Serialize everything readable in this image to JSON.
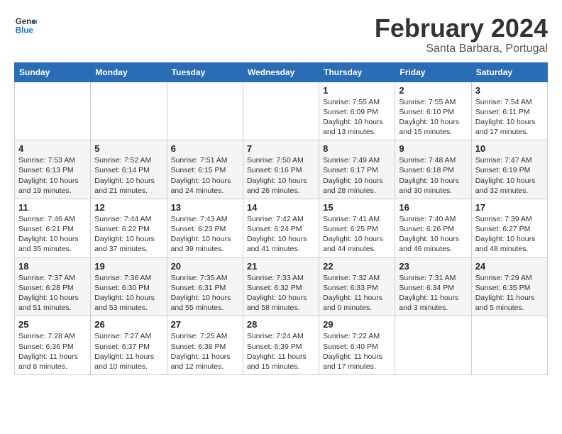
{
  "header": {
    "logo_line1": "General",
    "logo_line2": "Blue",
    "month_title": "February 2024",
    "location": "Santa Barbara, Portugal"
  },
  "weekdays": [
    "Sunday",
    "Monday",
    "Tuesday",
    "Wednesday",
    "Thursday",
    "Friday",
    "Saturday"
  ],
  "weeks": [
    [
      {
        "num": "",
        "info": ""
      },
      {
        "num": "",
        "info": ""
      },
      {
        "num": "",
        "info": ""
      },
      {
        "num": "",
        "info": ""
      },
      {
        "num": "1",
        "info": "Sunrise: 7:55 AM\nSunset: 6:09 PM\nDaylight: 10 hours\nand 13 minutes."
      },
      {
        "num": "2",
        "info": "Sunrise: 7:55 AM\nSunset: 6:10 PM\nDaylight: 10 hours\nand 15 minutes."
      },
      {
        "num": "3",
        "info": "Sunrise: 7:54 AM\nSunset: 6:11 PM\nDaylight: 10 hours\nand 17 minutes."
      }
    ],
    [
      {
        "num": "4",
        "info": "Sunrise: 7:53 AM\nSunset: 6:13 PM\nDaylight: 10 hours\nand 19 minutes."
      },
      {
        "num": "5",
        "info": "Sunrise: 7:52 AM\nSunset: 6:14 PM\nDaylight: 10 hours\nand 21 minutes."
      },
      {
        "num": "6",
        "info": "Sunrise: 7:51 AM\nSunset: 6:15 PM\nDaylight: 10 hours\nand 24 minutes."
      },
      {
        "num": "7",
        "info": "Sunrise: 7:50 AM\nSunset: 6:16 PM\nDaylight: 10 hours\nand 26 minutes."
      },
      {
        "num": "8",
        "info": "Sunrise: 7:49 AM\nSunset: 6:17 PM\nDaylight: 10 hours\nand 28 minutes."
      },
      {
        "num": "9",
        "info": "Sunrise: 7:48 AM\nSunset: 6:18 PM\nDaylight: 10 hours\nand 30 minutes."
      },
      {
        "num": "10",
        "info": "Sunrise: 7:47 AM\nSunset: 6:19 PM\nDaylight: 10 hours\nand 32 minutes."
      }
    ],
    [
      {
        "num": "11",
        "info": "Sunrise: 7:46 AM\nSunset: 6:21 PM\nDaylight: 10 hours\nand 35 minutes."
      },
      {
        "num": "12",
        "info": "Sunrise: 7:44 AM\nSunset: 6:22 PM\nDaylight: 10 hours\nand 37 minutes."
      },
      {
        "num": "13",
        "info": "Sunrise: 7:43 AM\nSunset: 6:23 PM\nDaylight: 10 hours\nand 39 minutes."
      },
      {
        "num": "14",
        "info": "Sunrise: 7:42 AM\nSunset: 6:24 PM\nDaylight: 10 hours\nand 41 minutes."
      },
      {
        "num": "15",
        "info": "Sunrise: 7:41 AM\nSunset: 6:25 PM\nDaylight: 10 hours\nand 44 minutes."
      },
      {
        "num": "16",
        "info": "Sunrise: 7:40 AM\nSunset: 6:26 PM\nDaylight: 10 hours\nand 46 minutes."
      },
      {
        "num": "17",
        "info": "Sunrise: 7:39 AM\nSunset: 6:27 PM\nDaylight: 10 hours\nand 48 minutes."
      }
    ],
    [
      {
        "num": "18",
        "info": "Sunrise: 7:37 AM\nSunset: 6:28 PM\nDaylight: 10 hours\nand 51 minutes."
      },
      {
        "num": "19",
        "info": "Sunrise: 7:36 AM\nSunset: 6:30 PM\nDaylight: 10 hours\nand 53 minutes."
      },
      {
        "num": "20",
        "info": "Sunrise: 7:35 AM\nSunset: 6:31 PM\nDaylight: 10 hours\nand 55 minutes."
      },
      {
        "num": "21",
        "info": "Sunrise: 7:33 AM\nSunset: 6:32 PM\nDaylight: 10 hours\nand 58 minutes."
      },
      {
        "num": "22",
        "info": "Sunrise: 7:32 AM\nSunset: 6:33 PM\nDaylight: 11 hours\nand 0 minutes."
      },
      {
        "num": "23",
        "info": "Sunrise: 7:31 AM\nSunset: 6:34 PM\nDaylight: 11 hours\nand 3 minutes."
      },
      {
        "num": "24",
        "info": "Sunrise: 7:29 AM\nSunset: 6:35 PM\nDaylight: 11 hours\nand 5 minutes."
      }
    ],
    [
      {
        "num": "25",
        "info": "Sunrise: 7:28 AM\nSunset: 6:36 PM\nDaylight: 11 hours\nand 8 minutes."
      },
      {
        "num": "26",
        "info": "Sunrise: 7:27 AM\nSunset: 6:37 PM\nDaylight: 11 hours\nand 10 minutes."
      },
      {
        "num": "27",
        "info": "Sunrise: 7:25 AM\nSunset: 6:38 PM\nDaylight: 11 hours\nand 12 minutes."
      },
      {
        "num": "28",
        "info": "Sunrise: 7:24 AM\nSunset: 6:39 PM\nDaylight: 11 hours\nand 15 minutes."
      },
      {
        "num": "29",
        "info": "Sunrise: 7:22 AM\nSunset: 6:40 PM\nDaylight: 11 hours\nand 17 minutes."
      },
      {
        "num": "",
        "info": ""
      },
      {
        "num": "",
        "info": ""
      }
    ]
  ]
}
